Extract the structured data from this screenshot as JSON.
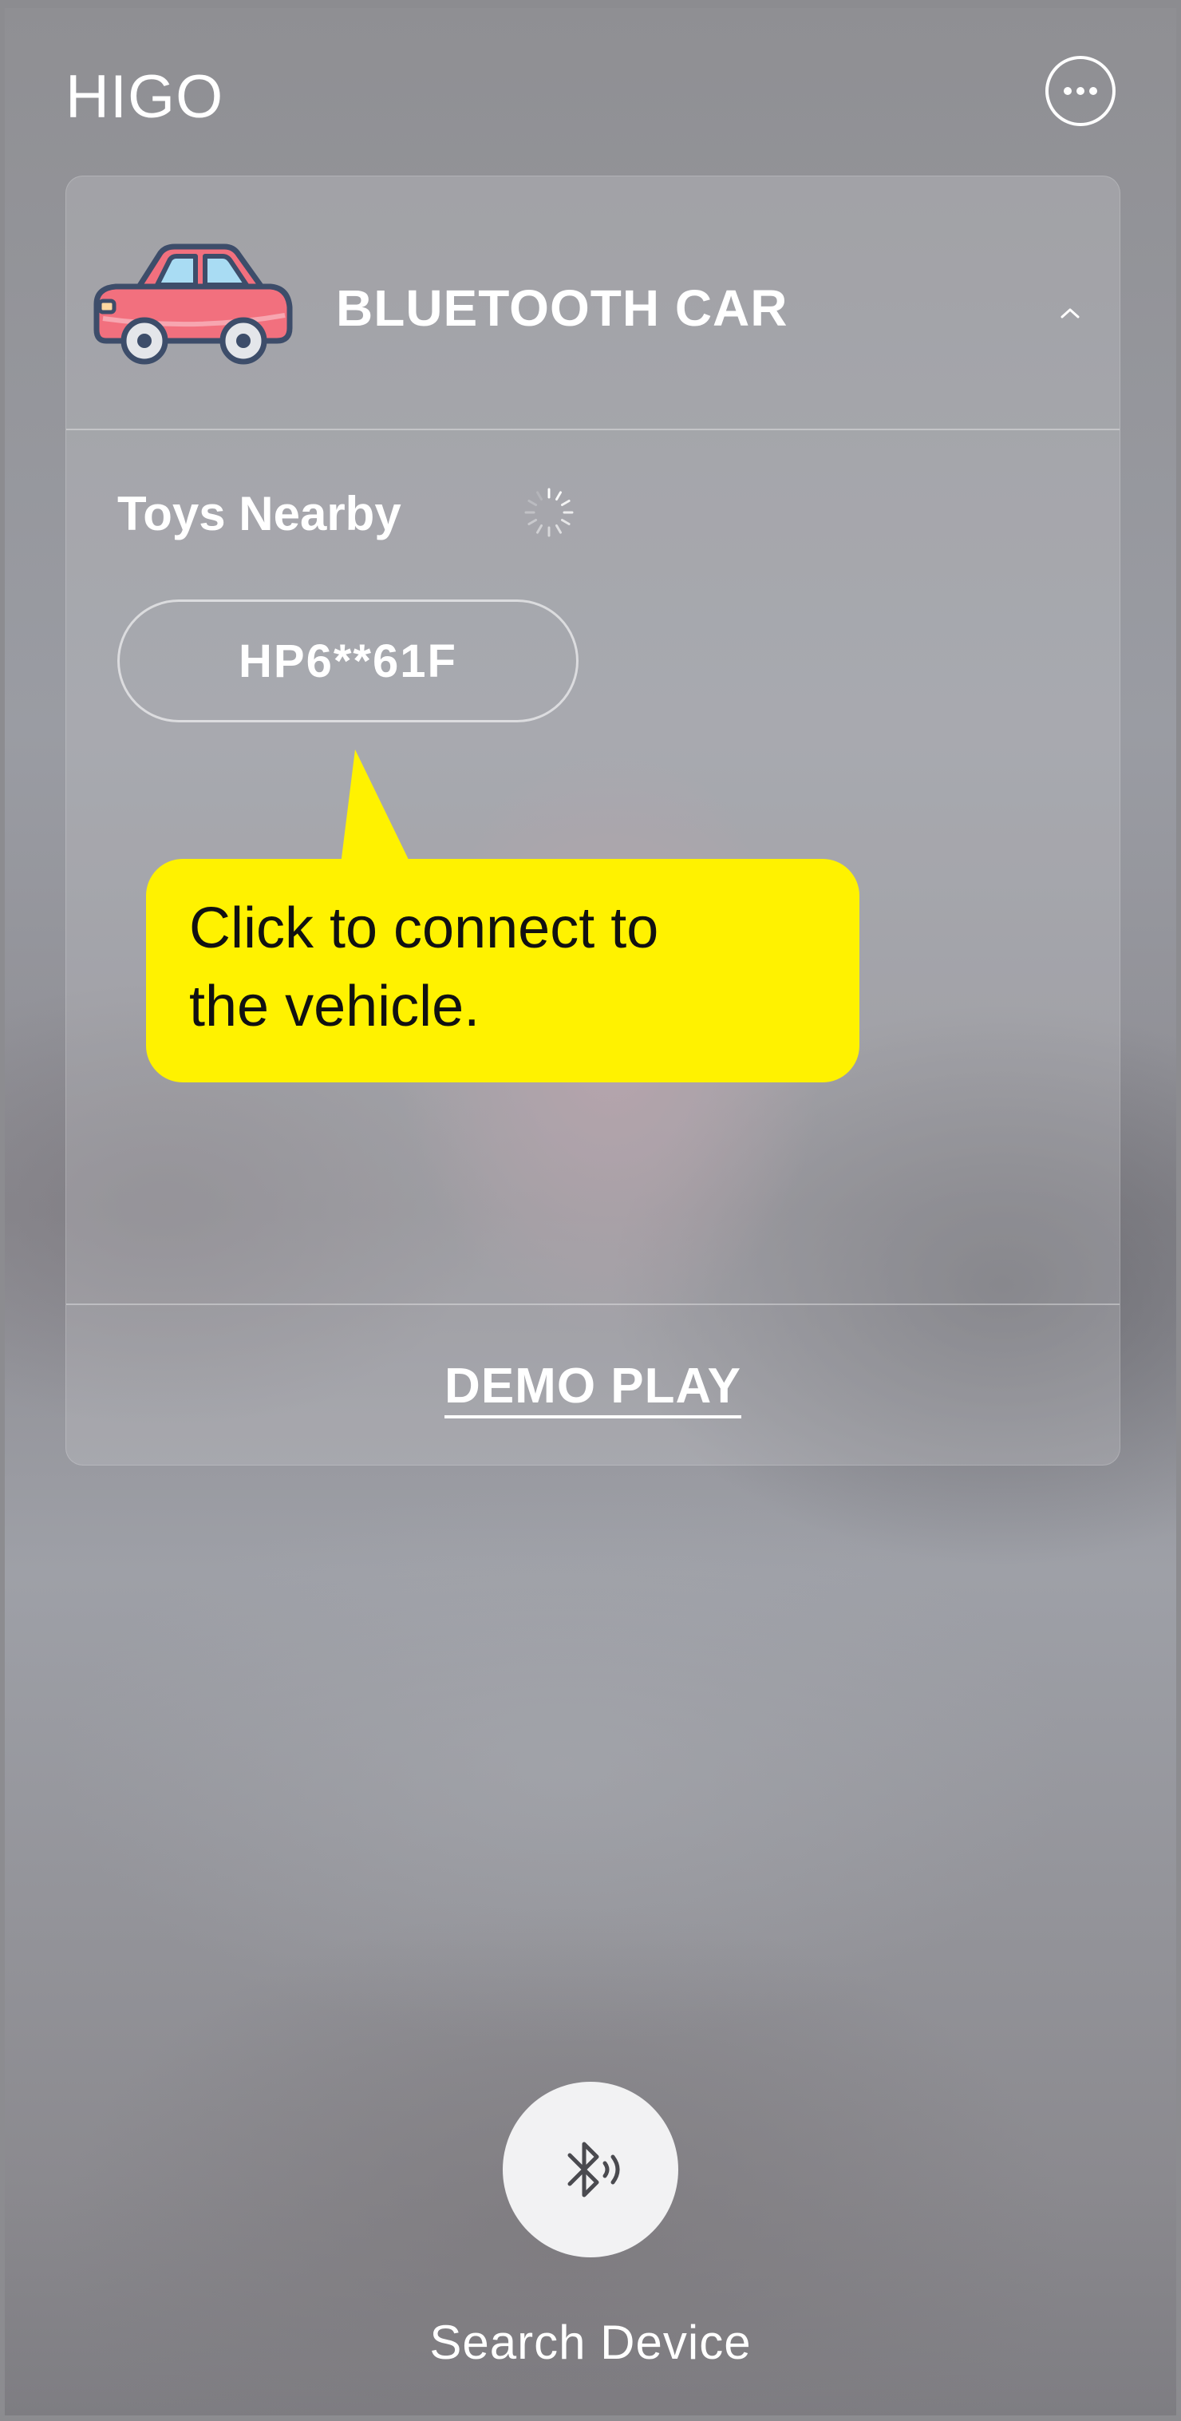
{
  "header": {
    "app_title": "HIGO",
    "more_icon": "more-horizontal-icon"
  },
  "device_card": {
    "title": "BLUETOOTH CAR",
    "car_icon": "car-icon",
    "collapse_icon": "chevron-up-icon",
    "nearby_label": "Toys Nearby",
    "scanning_icon": "loading-spinner-icon",
    "devices": [
      "HP6**61F"
    ],
    "demo_play_label": "DEMO PLAY"
  },
  "tooltip": {
    "text_line1": "Click to connect to",
    "text_line2": "the vehicle.",
    "color": "#fff200"
  },
  "search": {
    "icon": "bluetooth-search-icon",
    "label": "Search Device"
  },
  "colors": {
    "car_body": "#f2707e",
    "car_window": "#a9dcf3"
  }
}
